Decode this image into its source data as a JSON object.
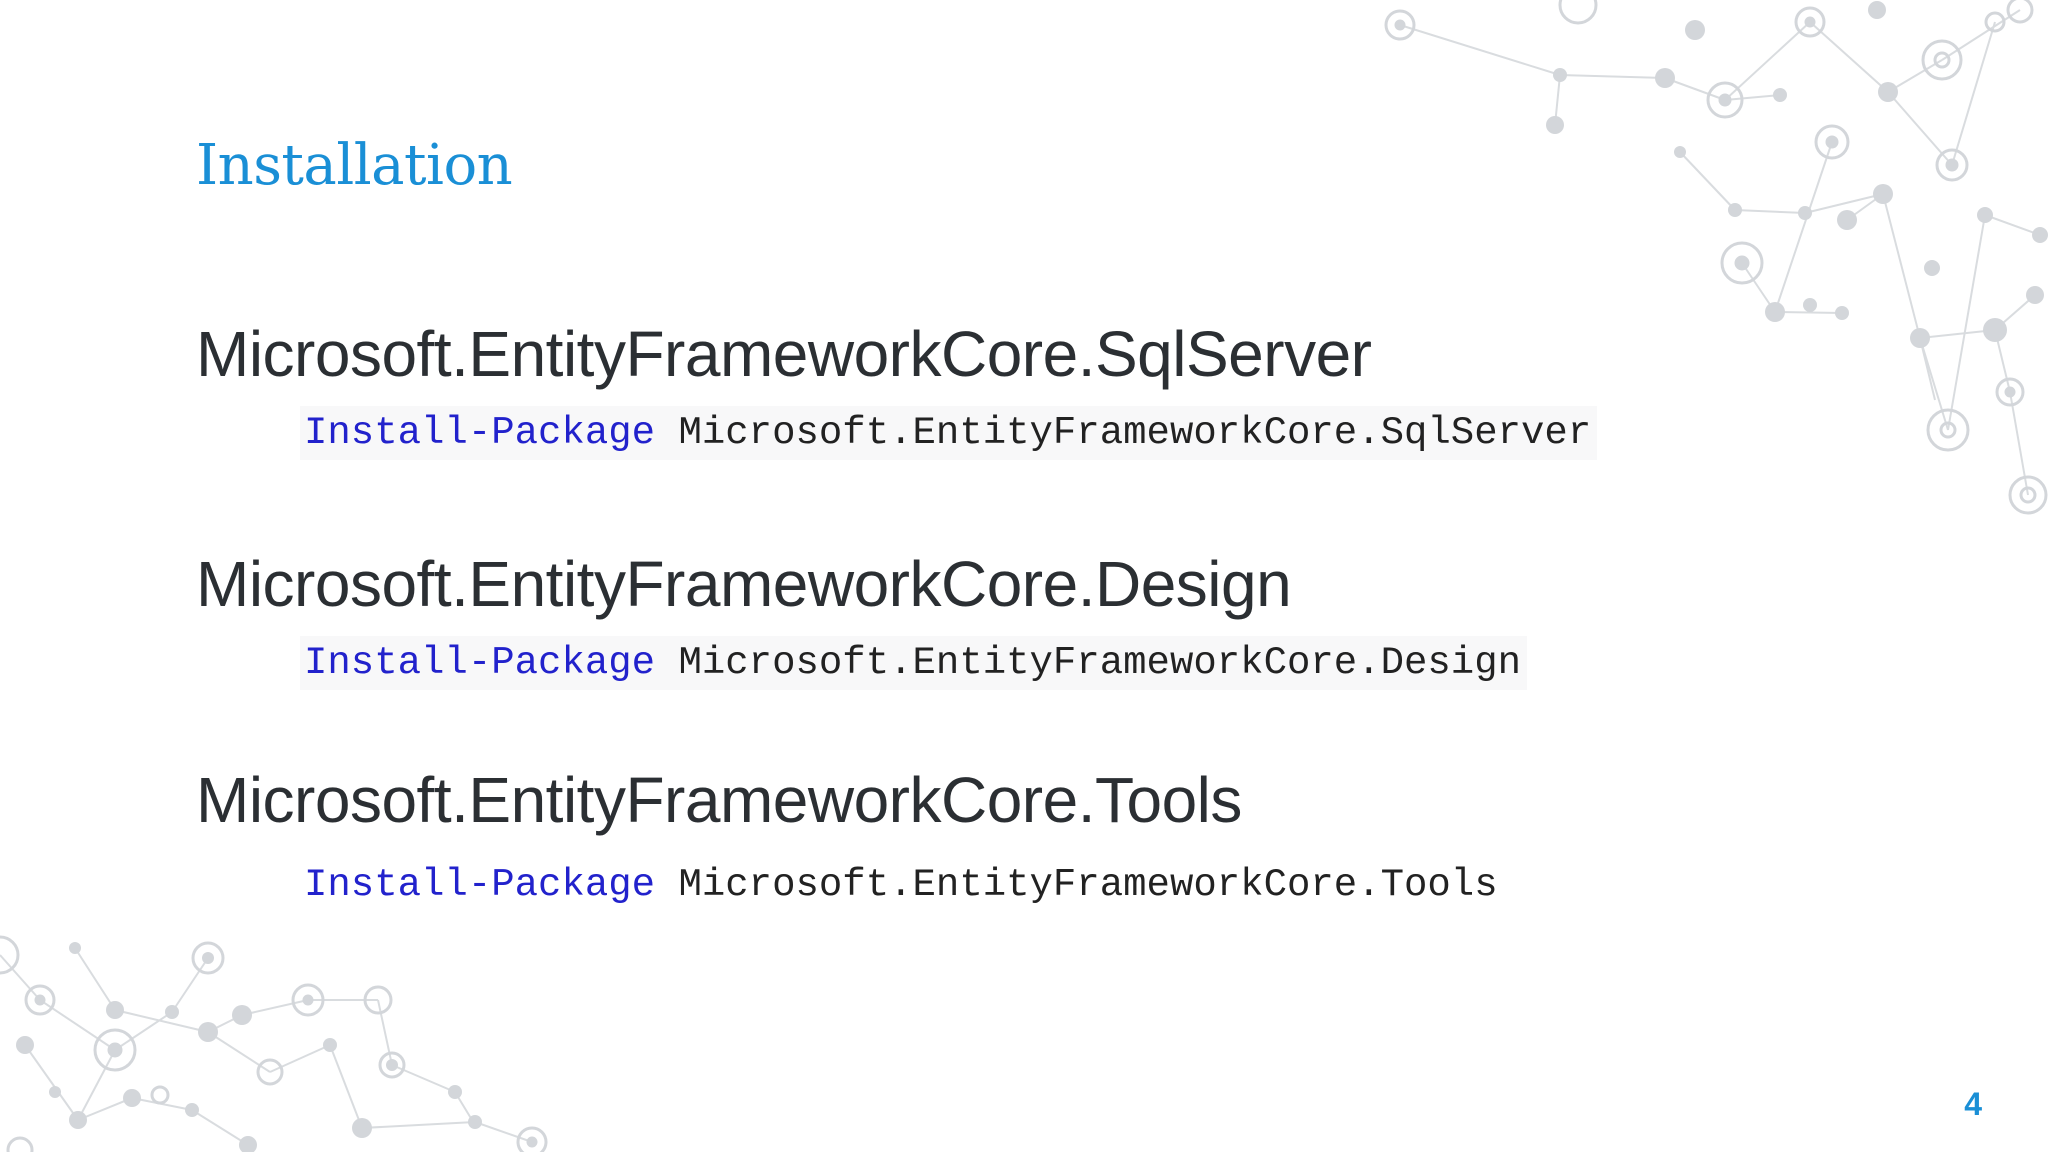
{
  "slide": {
    "title": "Installation",
    "page_number": "4",
    "sections": [
      {
        "heading": "Microsoft.EntityFrameworkCore.SqlServer",
        "command_keyword": "Install-Package",
        "command_argument": "Microsoft.EntityFrameworkCore.SqlServer"
      },
      {
        "heading": "Microsoft.EntityFrameworkCore.Design",
        "command_keyword": "Install-Package",
        "command_argument": "Microsoft.EntityFrameworkCore.Design"
      },
      {
        "heading": "Microsoft.EntityFrameworkCore.Tools",
        "command_keyword": "Install-Package",
        "command_argument": "Microsoft.EntityFrameworkCore.Tools"
      }
    ]
  },
  "colors": {
    "title": "#1a8fd6",
    "heading_text": "#2b2f33",
    "command_keyword": "#2222cc",
    "command_argument": "#222222",
    "decoration": "#c9cdd2"
  },
  "decoration": {
    "icon": "network-graph-icon"
  }
}
